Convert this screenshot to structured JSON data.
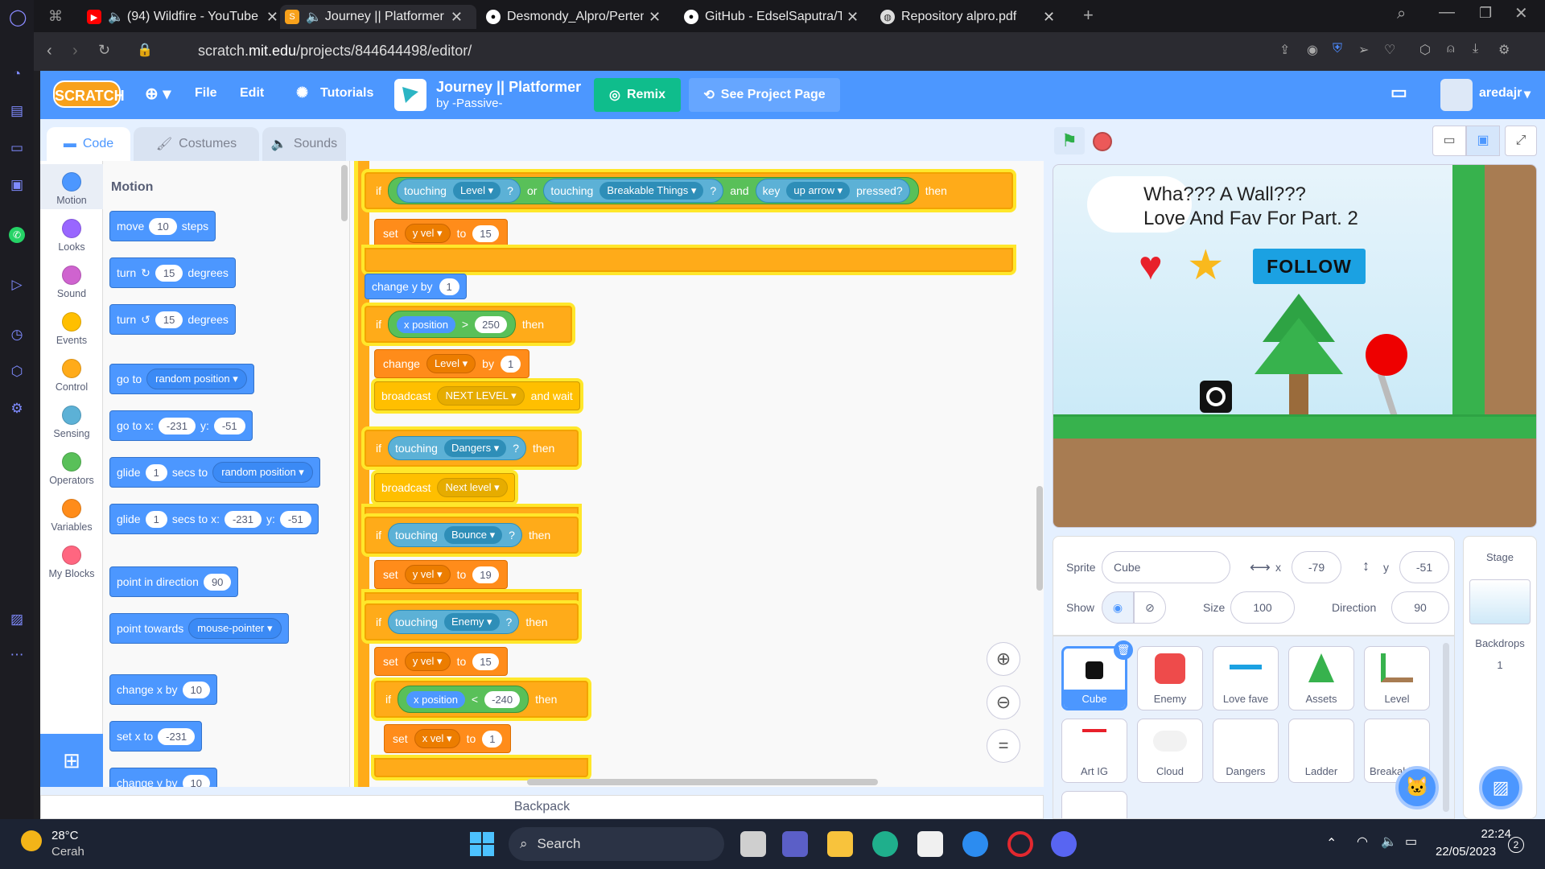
{
  "browser": {
    "tabs": [
      {
        "title": "(94) Wildfire - YouTube",
        "active": false
      },
      {
        "title": "Journey || Platformer on Scratch",
        "active": true
      },
      {
        "title": "Desmondy_Alpro/Pertemuan",
        "active": false
      },
      {
        "title": "GitHub - EdselSaputra/Tugas",
        "active": false
      },
      {
        "title": "Repository alpro.pdf",
        "active": false
      }
    ],
    "url_prefix": "scratch.",
    "url_domain": "mit.edu",
    "url_path": "/projects/844644498/editor/"
  },
  "menubar": {
    "logo": "SCRATCH",
    "file": "File",
    "edit": "Edit",
    "tutorials": "Tutorials",
    "project_title": "Journey || Platformer",
    "project_author": "by -Passive-",
    "remix": "Remix",
    "see_project": "See Project Page",
    "username": "aredajr"
  },
  "editor_tabs": {
    "code": "Code",
    "costumes": "Costumes",
    "sounds": "Sounds"
  },
  "categories": [
    {
      "label": "Motion",
      "color": "#4c97ff"
    },
    {
      "label": "Looks",
      "color": "#9966ff"
    },
    {
      "label": "Sound",
      "color": "#cf63cf"
    },
    {
      "label": "Events",
      "color": "#ffbf00"
    },
    {
      "label": "Control",
      "color": "#ffab19"
    },
    {
      "label": "Sensing",
      "color": "#5cb1d6"
    },
    {
      "label": "Operators",
      "color": "#59c059"
    },
    {
      "label": "Variables",
      "color": "#ff8c1a"
    },
    {
      "label": "My Blocks",
      "color": "#ff6680"
    }
  ],
  "palette": {
    "heading": "Motion",
    "move": {
      "pre": "move",
      "n": "10",
      "post": "steps"
    },
    "turn_right": {
      "pre": "turn",
      "n": "15",
      "post": "degrees"
    },
    "turn_left": {
      "pre": "turn",
      "n": "15",
      "post": "degrees"
    },
    "goto": {
      "pre": "go to",
      "dd": "random position"
    },
    "gotoxy": {
      "pre": "go to x:",
      "x": "-231",
      "ylbl": "y:",
      "y": "-51"
    },
    "glide": {
      "pre": "glide",
      "n": "1",
      "mid": "secs to",
      "dd": "random position"
    },
    "glidexy": {
      "pre": "glide",
      "n": "1",
      "mid": "secs to x:",
      "x": "-231",
      "ylbl": "y:",
      "y": "-51"
    },
    "point_dir": {
      "pre": "point in direction",
      "n": "90"
    },
    "point_towards": {
      "pre": "point towards",
      "dd": "mouse-pointer"
    },
    "change_x": {
      "pre": "change x by",
      "n": "10"
    },
    "set_x": {
      "pre": "set x to",
      "n": "-231"
    },
    "change_y": {
      "pre": "change y by",
      "n": "10"
    }
  },
  "code": {
    "if1": {
      "if": "if",
      "t1": "touching",
      "d1": "Level",
      "q": "?",
      "or": "or",
      "t2": "touching",
      "d2": "Breakable Things",
      "and": "and",
      "key": "key",
      "d3": "up arrow",
      "pressed": "pressed?",
      "then": "then"
    },
    "set1": {
      "set": "set",
      "d": "y vel",
      "to": "to",
      "n": "15"
    },
    "changey": {
      "pre": "change y by",
      "n": "1"
    },
    "if2": {
      "if": "if",
      "xp": "x position",
      "op": ">",
      "n": "250",
      "then": "then"
    },
    "change_level": {
      "pre": "change",
      "d": "Level",
      "by": "by",
      "n": "1"
    },
    "broadcast1": {
      "pre": "broadcast",
      "d": "NEXT LEVEL",
      "post": "and wait"
    },
    "if3": {
      "if": "if",
      "t": "touching",
      "d": "Dangers",
      "q": "?",
      "then": "then"
    },
    "broadcast2": {
      "pre": "broadcast",
      "d": "Next level"
    },
    "if4": {
      "if": "if",
      "t": "touching",
      "d": "Bounce",
      "q": "?",
      "then": "then"
    },
    "set2": {
      "set": "set",
      "d": "y vel",
      "to": "to",
      "n": "19"
    },
    "if5": {
      "if": "if",
      "t": "touching",
      "d": "Enemy",
      "q": "?",
      "then": "then"
    },
    "set3": {
      "set": "set",
      "d": "y vel",
      "to": "to",
      "n": "15"
    },
    "if6": {
      "if": "if",
      "xp": "x position",
      "op": "<",
      "n": "-240",
      "then": "then"
    },
    "set4": {
      "set": "set",
      "d": "x vel",
      "to": "to",
      "n": "1"
    }
  },
  "backpack": "Backpack",
  "stage": {
    "line1": "Wha??? A Wall???",
    "line2": "Love And Fav For Part. 2",
    "follow": "FOLLOW"
  },
  "sprite_info": {
    "sprite_label": "Sprite",
    "sprite_name": "Cube",
    "x_label": "x",
    "x": "-79",
    "y_label": "y",
    "y": "-51",
    "show_label": "Show",
    "size_label": "Size",
    "size": "100",
    "direction_label": "Direction",
    "direction": "90"
  },
  "sprites": [
    "Cube",
    "Enemy",
    "Love fave",
    "Assets",
    "Level",
    "Art IG",
    "Cloud",
    "Dangers",
    "Ladder",
    "Breakable"
  ],
  "stage_panel": {
    "title": "Stage",
    "backdrops_label": "Backdrops",
    "backdrops_count": "1"
  },
  "taskbar": {
    "temp": "28°C",
    "weather": "Cerah",
    "search": "Search",
    "time": "22:24",
    "date": "22/05/2023",
    "notif": "2"
  }
}
